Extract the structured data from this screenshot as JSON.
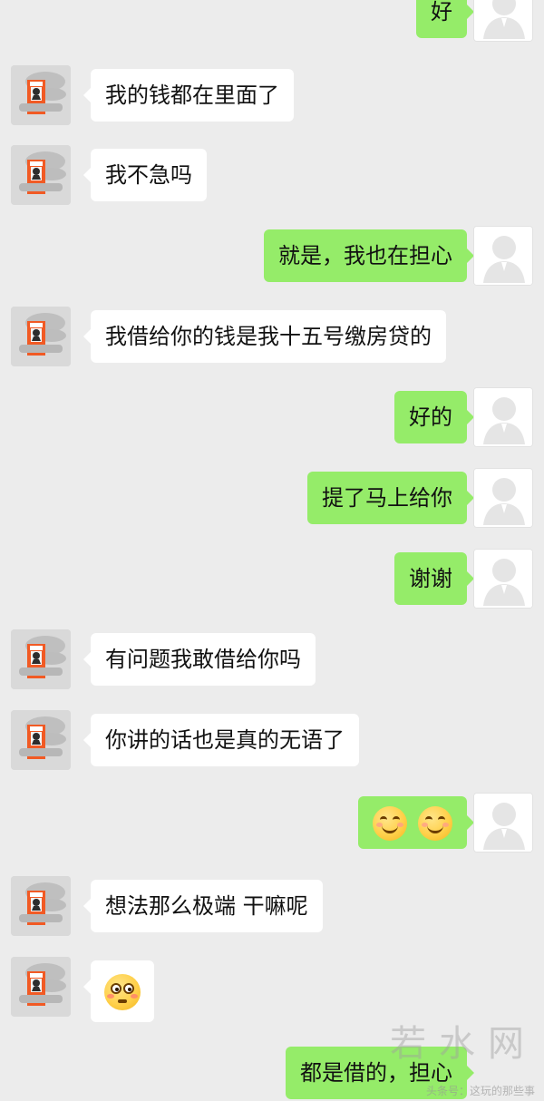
{
  "messages": [
    {
      "side": "right",
      "text": "好",
      "kind": "text"
    },
    {
      "side": "left",
      "text": "我的钱都在里面了",
      "kind": "text"
    },
    {
      "side": "left",
      "text": "我不急吗",
      "kind": "text"
    },
    {
      "side": "right",
      "text": "就是，我也在担心",
      "kind": "text"
    },
    {
      "side": "left",
      "text": "我借给你的钱是我十五号缴房贷的",
      "kind": "text"
    },
    {
      "side": "right",
      "text": "好的",
      "kind": "text"
    },
    {
      "side": "right",
      "text": "提了马上给你",
      "kind": "text"
    },
    {
      "side": "right",
      "text": "谢谢",
      "kind": "text"
    },
    {
      "side": "left",
      "text": "有问题我敢借给你吗",
      "kind": "text"
    },
    {
      "side": "left",
      "text": "你讲的话也是真的无语了",
      "kind": "text"
    },
    {
      "side": "right",
      "text": "😊😊",
      "kind": "emoji"
    },
    {
      "side": "left",
      "text": "想法那么极端 干嘛呢",
      "kind": "text"
    },
    {
      "side": "left",
      "text": "😳",
      "kind": "emoji"
    },
    {
      "side": "right",
      "text": "都是借的，担心",
      "kind": "text"
    }
  ],
  "watermark": {
    "text": "若水网",
    "footer": "头条号：这玩的那些事"
  },
  "colors": {
    "background": "#ececec",
    "incoming_bubble": "#ffffff",
    "outgoing_bubble": "#95ec69"
  },
  "icons": {
    "left_avatar": "badge-photo-avatar",
    "right_avatar": "default-user-avatar",
    "smile_emoji": "smiling-face-icon",
    "flushed_emoji": "flushed-face-icon"
  }
}
